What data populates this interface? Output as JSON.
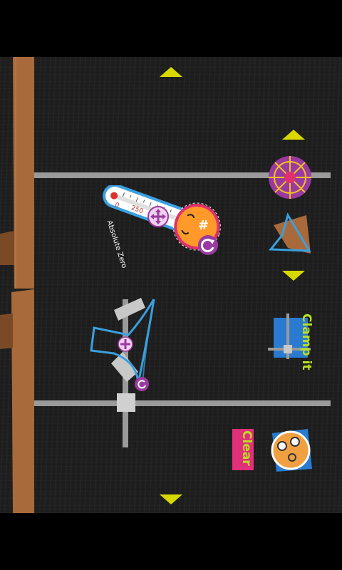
{
  "thermometer": {
    "scale_min": "0",
    "scale_mid": "250",
    "caption": "Absolute Zero"
  },
  "toolbar": {
    "clamp_label": "Clamp it",
    "clear_label": "Clear"
  },
  "colors": {
    "background": "#1d1d1d",
    "wood": "#a86a3a",
    "rail": "#9a9a9a",
    "arrow": "#d8d800",
    "accent_blue": "#3aa0e0",
    "accent_purple": "#9a3aa0"
  },
  "icons": [
    "scroll-up-arrow-icon",
    "scroll-down-arrow-icon",
    "move-icon",
    "rotate-icon",
    "prize-wheel-icon",
    "paper-plane-icon",
    "face-icon"
  ]
}
